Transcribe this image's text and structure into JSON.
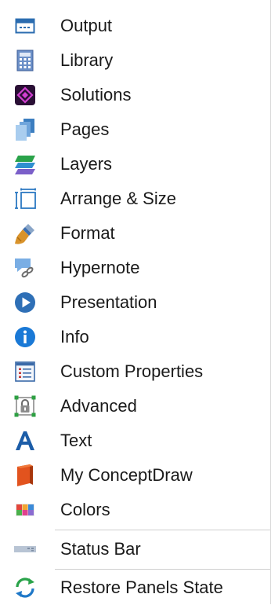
{
  "menu": {
    "items": [
      {
        "label": "Output",
        "icon": "output-icon"
      },
      {
        "label": "Library",
        "icon": "library-icon"
      },
      {
        "label": "Solutions",
        "icon": "solutions-icon"
      },
      {
        "label": "Pages",
        "icon": "pages-icon"
      },
      {
        "label": "Layers",
        "icon": "layers-icon"
      },
      {
        "label": "Arrange & Size",
        "icon": "arrange-size-icon"
      },
      {
        "label": "Format",
        "icon": "format-brush-icon"
      },
      {
        "label": "Hypernote",
        "icon": "hypernote-icon"
      },
      {
        "label": "Presentation",
        "icon": "presentation-play-icon"
      },
      {
        "label": "Info",
        "icon": "info-icon"
      },
      {
        "label": "Custom Properties",
        "icon": "custom-properties-icon"
      },
      {
        "label": "Advanced",
        "icon": "advanced-lock-icon"
      },
      {
        "label": "Text",
        "icon": "text-icon"
      },
      {
        "label": "My ConceptDraw",
        "icon": "my-conceptdraw-icon"
      },
      {
        "label": "Colors",
        "icon": "colors-icon"
      }
    ],
    "status_bar": {
      "label": "Status Bar",
      "icon": "status-bar-icon"
    },
    "restore": {
      "label": "Restore Panels State",
      "icon": "restore-refresh-icon"
    }
  }
}
